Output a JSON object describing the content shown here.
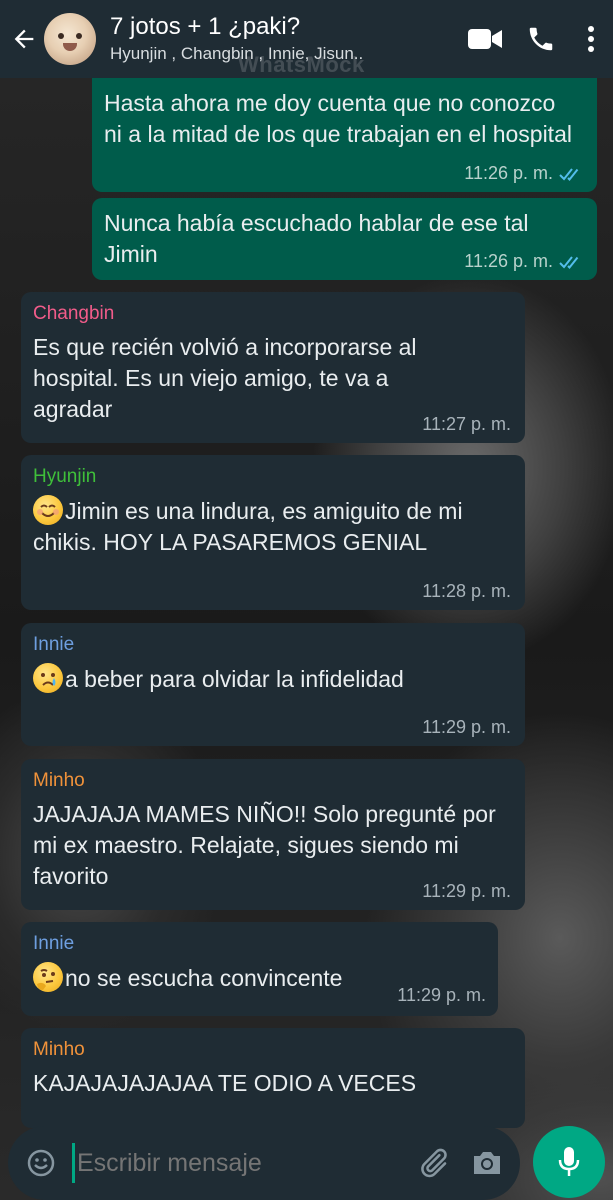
{
  "header": {
    "title": "7 jotos  + 1 ¿paki?",
    "subtitle": "Hyunjin , Changbin , Innie, Jisun..",
    "watermark": "WhatsMock",
    "icons": [
      "back-arrow-icon",
      "video-call-icon",
      "phone-icon",
      "more-vert-icon"
    ]
  },
  "messages": [
    {
      "direction": "out",
      "text": "Hasta ahora me doy cuenta que no conozco ni a la mitad de los que trabajan en el hospital",
      "time": "11:26 p. m.",
      "status": "read"
    },
    {
      "direction": "out",
      "text": "Nunca había escuchado hablar de ese tal Jimin",
      "time": "11:26 p. m.",
      "status": "read"
    },
    {
      "direction": "in",
      "sender": "Changbin",
      "sender_color": "#f15c8a",
      "text": "Es que recién volvió a incorporarse al hospital. Es un viejo amigo, te va a agradar",
      "time": "11:27 p. m."
    },
    {
      "direction": "in",
      "sender": "Hyunjin",
      "sender_color": "#3fbf3a",
      "emoji": "smiling-face-icon",
      "text": "Jimin es una lindura, es  amiguito de mi chikis. HOY LA PASAREMOS GENIAL",
      "time": "11:28 p. m."
    },
    {
      "direction": "in",
      "sender": "Innie",
      "sender_color": "#6e9fe0",
      "emoji": "crying-face-icon",
      "text": "a beber para olvidar la infidelidad",
      "time": "11:29 p. m."
    },
    {
      "direction": "in",
      "sender": "Minho",
      "sender_color": "#f0923a",
      "text": "JAJAJAJA MAMES NIÑO!! Solo pregunté por mi ex maestro. Relajate, sigues siendo mi favorito",
      "time": "11:29 p. m."
    },
    {
      "direction": "in",
      "sender": "Innie",
      "sender_color": "#6e9fe0",
      "emoji": "thinking-face-icon",
      "text": "no se escucha convincente",
      "time": "11:29 p. m."
    },
    {
      "direction": "in",
      "sender": "Minho",
      "sender_color": "#f0923a",
      "text": "KAJAJAJAJAJAA TE ODIO A VECES",
      "time": ""
    }
  ],
  "composer": {
    "placeholder": "Escribir mensaje",
    "icons": [
      "emoji-icon",
      "attach-icon",
      "camera-icon",
      "mic-icon"
    ]
  },
  "colors": {
    "header_bg": "#1f2c34",
    "outgoing_bubble": "#005c4b",
    "incoming_bubble": "#1f2c34",
    "accent": "#00a884",
    "read_ticks": "#53bdeb"
  }
}
